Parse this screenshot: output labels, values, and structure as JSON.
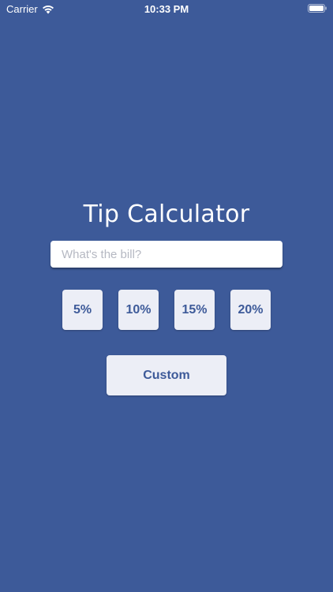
{
  "status_bar": {
    "carrier": "Carrier",
    "time": "10:33 PM",
    "wifi_icon": "wifi-icon",
    "battery_icon": "battery-icon"
  },
  "title": "Tip Calculator",
  "bill_input": {
    "value": "",
    "placeholder": "What's the bill?"
  },
  "tip_buttons": [
    {
      "label": "5%"
    },
    {
      "label": "10%"
    },
    {
      "label": "15%"
    },
    {
      "label": "20%"
    }
  ],
  "custom_button": {
    "label": "Custom"
  },
  "colors": {
    "background": "#3d5a99",
    "button_background": "#eceef6",
    "button_text": "#3d5a99",
    "title_text": "#ffffff"
  }
}
